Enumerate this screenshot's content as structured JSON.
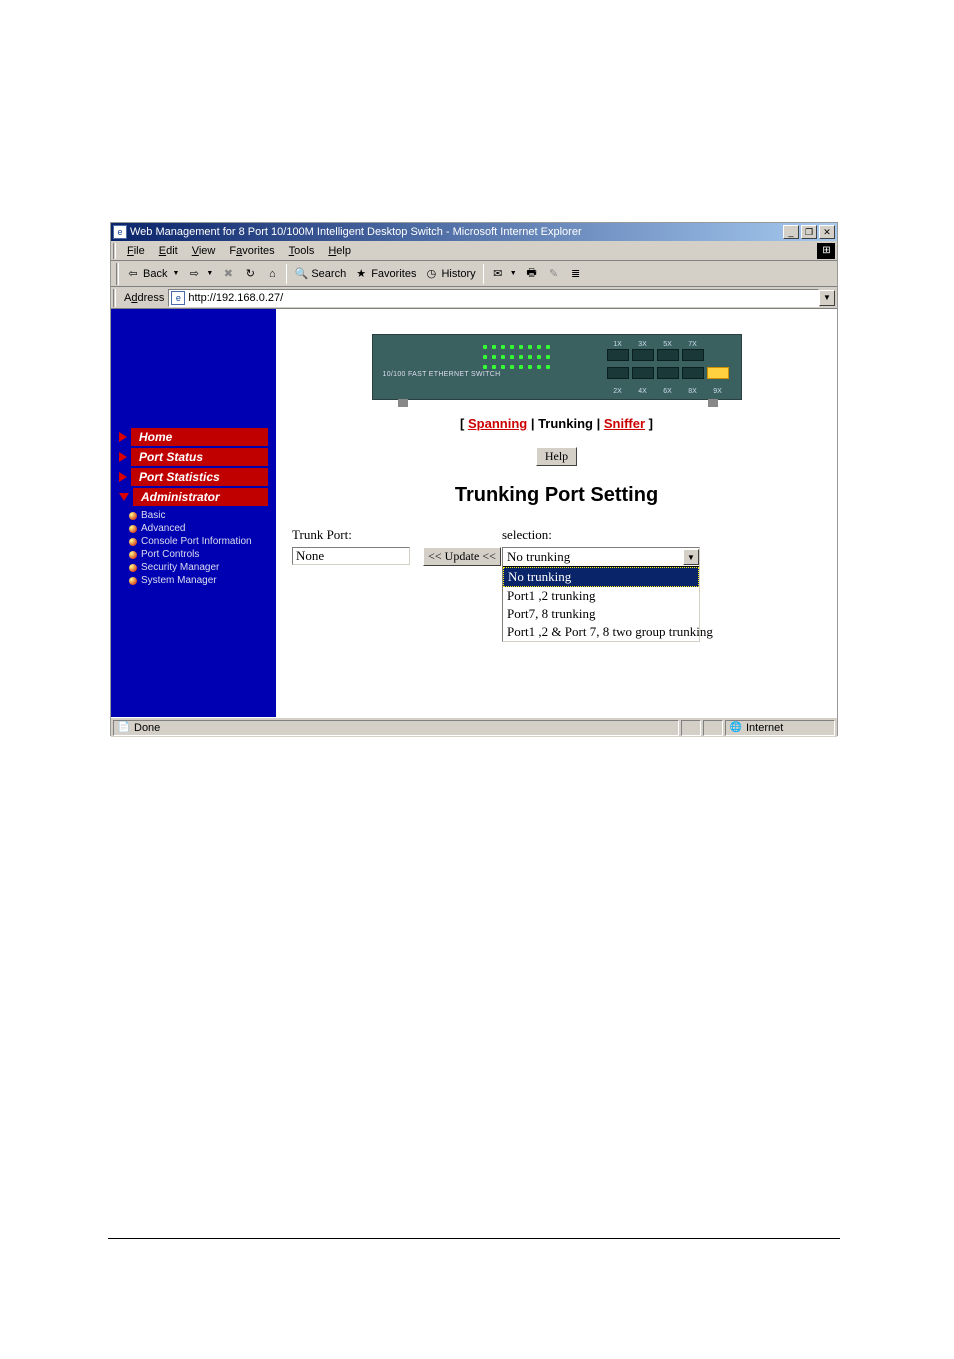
{
  "window": {
    "title": "Web Management for 8 Port 10/100M Intelligent Desktop Switch - Microsoft Internet Explorer",
    "min": "_",
    "max": "❐",
    "close": "✕"
  },
  "menu": {
    "file": "File",
    "edit": "Edit",
    "view": "View",
    "favorites": "Favorites",
    "tools": "Tools",
    "help": "Help"
  },
  "toolbar": {
    "back_icon": "⇦",
    "back": "Back",
    "fwd_icon": "⇨",
    "stop_icon": "✖",
    "refresh_icon": "↻",
    "home_icon": "⌂",
    "search_icon": "🔍",
    "search": "Search",
    "fav_icon": "★",
    "favorites": "Favorites",
    "history_icon": "◷",
    "history": "History",
    "mail_icon": "✉",
    "print_icon": "🖶",
    "edit_icon": "✎",
    "discuss_icon": "≣"
  },
  "address": {
    "label": "Address",
    "value": "http://192.168.0.27/"
  },
  "sidebar": {
    "items": [
      {
        "label": "Home"
      },
      {
        "label": "Port Status"
      },
      {
        "label": "Port Statistics"
      },
      {
        "label": "Administrator"
      }
    ],
    "sub": [
      {
        "label": "Basic"
      },
      {
        "label": "Advanced"
      },
      {
        "label": "Console Port Information"
      },
      {
        "label": "Port Controls"
      },
      {
        "label": "Security Manager"
      },
      {
        "label": "System Manager"
      }
    ]
  },
  "switch": {
    "label": "10/100 FAST ETHERNET SWITCH",
    "top_ports": [
      "1X",
      "3X",
      "5X",
      "7X"
    ],
    "bot_ports": [
      "2X",
      "4X",
      "6X",
      "8X",
      "9X"
    ]
  },
  "main": {
    "bracket_open": "[ ",
    "link1": "Spanning",
    "sep": " | ",
    "link2_text": "Trunking",
    "link3": "Sniffer",
    "bracket_close": " ]",
    "help": "Help",
    "heading": "Trunking Port Setting",
    "trunk_label": "Trunk Port:",
    "trunk_value": "None",
    "update": "<< Update <<",
    "selection_label": "selection:",
    "selection_value": "No trunking",
    "options": [
      "No trunking",
      "Port1 ,2 trunking",
      "Port7, 8 trunking",
      "Port1 ,2 & Port 7, 8 two group trunking"
    ]
  },
  "status": {
    "done_icon": "📄",
    "done": "Done",
    "net_icon": "🌐",
    "internet": "Internet"
  }
}
